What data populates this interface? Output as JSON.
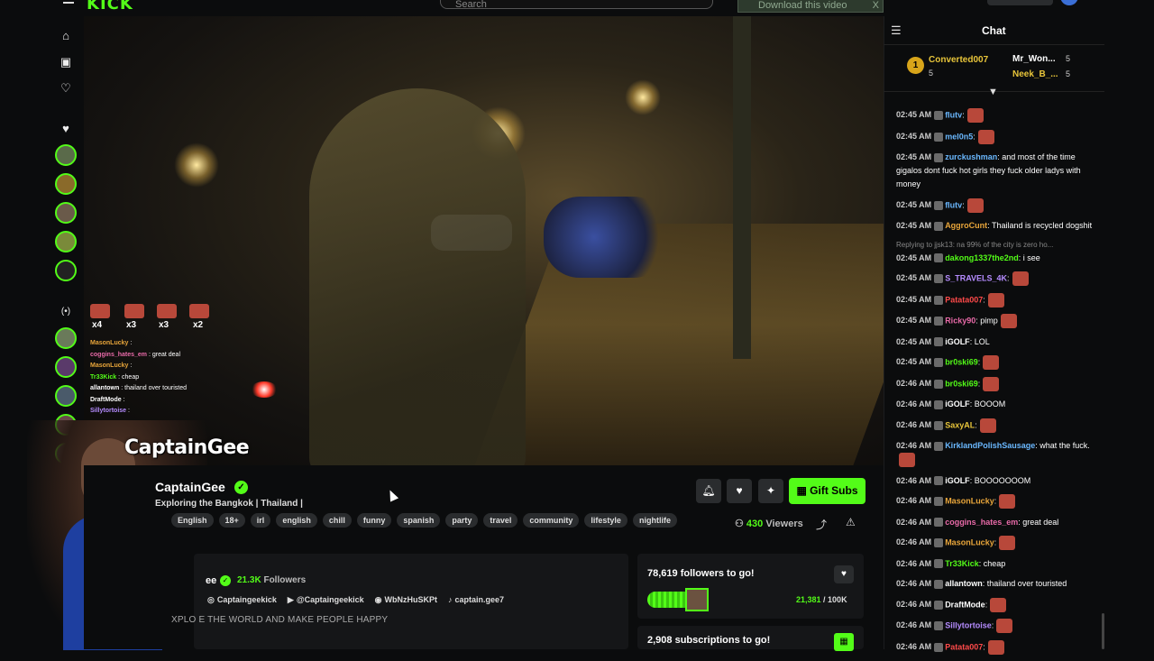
{
  "topbar": {
    "search_placeholder": "Search",
    "download_label": "Download this video",
    "download_close": "X"
  },
  "sidebar": {
    "icons": [
      "home-icon",
      "following-icon",
      "heart-icon",
      "live-icon"
    ],
    "live_label": "(•)"
  },
  "video": {
    "gift_counts": [
      "x4",
      "x3",
      "x3",
      "x2"
    ],
    "overlay_chat": [
      {
        "user": "MasonLucky",
        "text": ":",
        "color": "#e8a53a"
      },
      {
        "user": "coggins_hates_em",
        "text": ": great deal",
        "color": "#e86aa8"
      },
      {
        "user": "MasonLucky",
        "text": ":",
        "color": "#e8a53a"
      },
      {
        "user": "Tr33Kick",
        "text": ": cheap",
        "color": "#53fc18"
      },
      {
        "user": "allantown",
        "text": ": thailand over touristed",
        "color": "#ffffff"
      },
      {
        "user": "DraftMode",
        "text": ":",
        "color": "#ffffff"
      },
      {
        "user": "Sillytortoise",
        "text": ":",
        "color": "#b58cff"
      }
    ],
    "cam_name": "CaptainGee"
  },
  "stream": {
    "name": "CaptainGee",
    "verified": "✓",
    "title": "Exploring the Bangkok | Thailand |",
    "tags": [
      "English",
      "18+",
      "irl",
      "english",
      "chill",
      "funny",
      "spanish",
      "party",
      "travel",
      "community",
      "lifestyle",
      "nightlife"
    ],
    "gift_subs_label": "Gift Subs",
    "viewer_count": "430",
    "viewers_label": "Viewers"
  },
  "about": {
    "name": "ee",
    "followers_count": "21.3K",
    "followers_label": "Followers",
    "socials": [
      {
        "icon": "instagram-icon",
        "glyph": "◎",
        "label": "Captaingeekick"
      },
      {
        "icon": "youtube-icon",
        "glyph": "▶",
        "label": "@Captaingeekick"
      },
      {
        "icon": "discord-icon",
        "glyph": "◉",
        "label": "WbNzHuSKPt"
      },
      {
        "icon": "tiktok-icon",
        "glyph": "♪",
        "label": "captain.gee7"
      }
    ],
    "bio": "XPLO   E THE WORLD AND MAKE PEOPLE HAPPY"
  },
  "goals": {
    "followers_title": "78,619 followers to go!",
    "followers_current": "21,381",
    "followers_target": "/ 100K",
    "followers_progress": 0.21,
    "subs_title": "2,908 subscriptions to go!"
  },
  "chat": {
    "title": "Chat",
    "leaderboard": [
      {
        "rank": "1",
        "user": "Converted007",
        "count": "5",
        "color": "#e8c53a"
      },
      {
        "user": "Mr_Won...",
        "count": "5",
        "color": "#ffffff"
      },
      {
        "user": "Neek_B_...",
        "count": "5",
        "color": "#e8c53a"
      }
    ],
    "messages": [
      {
        "time": "02:45 AM",
        "user": "flutv",
        "text": ":",
        "color": "#6ab8ff",
        "emote": true
      },
      {
        "time": "02:45 AM",
        "user": "mel0n5",
        "text": ":",
        "color": "#6ab8ff",
        "emote": true
      },
      {
        "time": "02:45 AM",
        "user": "zurckushman",
        "text": ": and most of the time gigalos dont fuck hot girls they fuck older ladys with money",
        "color": "#6ab8ff",
        "emote": false
      },
      {
        "time": "02:45 AM",
        "user": "flutv",
        "text": ":",
        "color": "#6ab8ff",
        "emote": true
      },
      {
        "time": "02:45 AM",
        "user": "AggroCunt",
        "text": ": Thailand is recycled dogshit",
        "color": "#e8a53a",
        "emote": false
      },
      {
        "reply": "Replying to jjsk13: na 99% of the city is zero ho...",
        "time": "02:45 AM",
        "user": "dakong1337the2nd",
        "text": ": i see",
        "color": "#53fc18",
        "emote": false
      },
      {
        "time": "02:45 AM",
        "user": "S_TRAVELS_4K",
        "text": ":",
        "color": "#b58cff",
        "emote": true
      },
      {
        "time": "02:45 AM",
        "user": "Patata007",
        "text": ":",
        "color": "#ff4a4a",
        "emote": true
      },
      {
        "time": "02:45 AM",
        "user": "Ricky90",
        "text": ": pimp",
        "color": "#e86aa8",
        "emote": true
      },
      {
        "time": "02:45 AM",
        "user": "iGOLF",
        "text": ": LOL",
        "color": "#ffffff",
        "emote": false
      },
      {
        "time": "02:45 AM",
        "user": "br0ski69",
        "text": ":",
        "color": "#53fc18",
        "emote": true
      },
      {
        "time": "02:46 AM",
        "user": "br0ski69",
        "text": ":",
        "color": "#53fc18",
        "emote": true
      },
      {
        "time": "02:46 AM",
        "user": "iGOLF",
        "text": ": BOOOM",
        "color": "#ffffff",
        "emote": false
      },
      {
        "time": "02:46 AM",
        "user": "SaxyAL",
        "text": ":",
        "color": "#e8c53a",
        "emote": true
      },
      {
        "time": "02:46 AM",
        "user": "KirklandPolishSausage",
        "text": ": what the fuck.",
        "color": "#6ab8ff",
        "emote": true
      },
      {
        "time": "02:46 AM",
        "user": "iGOLF",
        "text": ": BOOOOOOOM",
        "color": "#ffffff",
        "emote": false
      },
      {
        "time": "02:46 AM",
        "user": "MasonLucky",
        "text": ":",
        "color": "#e8a53a",
        "emote": true
      },
      {
        "time": "02:46 AM",
        "user": "coggins_hates_em",
        "text": ": great deal",
        "color": "#e86aa8",
        "emote": false
      },
      {
        "time": "02:46 AM",
        "user": "MasonLucky",
        "text": ":",
        "color": "#e8a53a",
        "emote": true
      },
      {
        "time": "02:46 AM",
        "user": "Tr33Kick",
        "text": ": cheap",
        "color": "#53fc18",
        "emote": false
      },
      {
        "time": "02:46 AM",
        "user": "allantown",
        "text": ": thailand over touristed",
        "color": "#ffffff",
        "emote": false
      },
      {
        "time": "02:46 AM",
        "user": "DraftMode",
        "text": ":",
        "color": "#ffffff",
        "emote": true
      },
      {
        "time": "02:46 AM",
        "user": "Sillytortoise",
        "text": ":",
        "color": "#b58cff",
        "emote": true
      },
      {
        "time": "02:46 AM",
        "user": "Patata007",
        "text": ":",
        "color": "#ff4a4a",
        "emote": true
      }
    ]
  },
  "colors": {
    "accent": "#53fc18",
    "background": "#0b0c0d",
    "panel": "#151618"
  }
}
